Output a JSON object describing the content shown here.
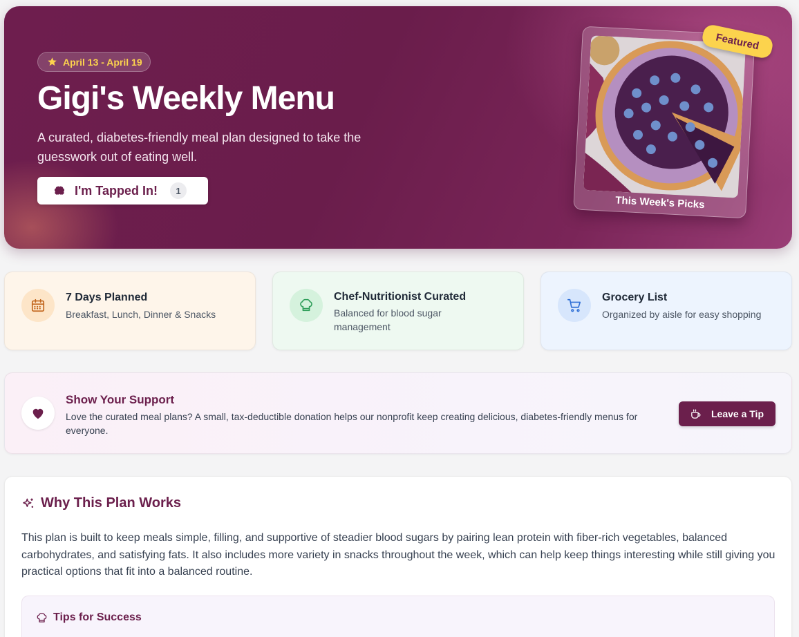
{
  "hero": {
    "date_range": "April 13 - April 19",
    "title": "Gigi's Weekly Menu",
    "subtitle": "A curated, diabetes-friendly meal plan designed to take the guesswork out of eating well.",
    "tap_button_label": "I'm Tapped In!",
    "tap_count": "1",
    "featured_badge": "Featured",
    "photo_caption": "This Week's Picks",
    "icons": {
      "date": "star-icon",
      "tap": "brain-icon"
    }
  },
  "features": [
    {
      "title": "7 Days Planned",
      "description": "Breakfast, Lunch, Dinner & Snacks",
      "icon": "calendar-icon",
      "color": "#c2661d"
    },
    {
      "title": "Chef-Nutritionist Curated",
      "description": "Balanced for blood sugar management",
      "icon": "chef-hat-icon",
      "color": "#2f9e5a"
    },
    {
      "title": "Grocery List",
      "description": "Organized by aisle for easy shopping",
      "icon": "cart-icon",
      "color": "#2f6fd6"
    }
  ],
  "support": {
    "title": "Show Your Support",
    "description": "Love the curated meal plans? A small, tax-deductible donation helps our nonprofit keep creating delicious, diabetes-friendly menus for everyone.",
    "button_label": "Leave a Tip",
    "icon": "heart-icon",
    "button_icon": "coffee-icon"
  },
  "why": {
    "title": "Why This Plan Works",
    "body": "This plan is built to keep meals simple, filling, and supportive of steadier blood sugars by pairing lean protein with fiber-rich vegetables, balanced carbohydrates, and satisfying fats. It also includes more variety in snacks throughout the week, which can help keep things interesting while still giving you practical options that fit into a balanced routine.",
    "tips_title": "Tips for Success",
    "icon": "sparkles-icon",
    "tips_icon": "chef-hat-icon"
  },
  "colors": {
    "brand": "#6b1f4c",
    "accent": "#fcd34d",
    "background": "#f4f4f5"
  }
}
